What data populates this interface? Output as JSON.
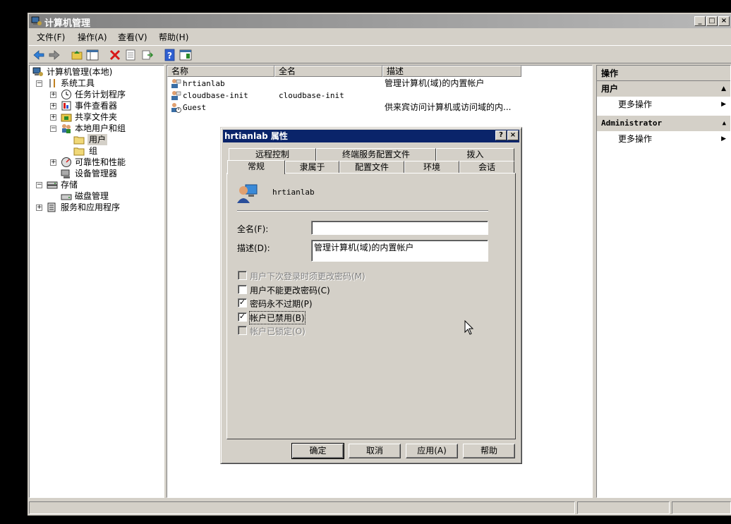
{
  "window": {
    "title": "计算机管理",
    "min": "_",
    "max": "□",
    "close": "×"
  },
  "menu": [
    "文件(F)",
    "操作(A)",
    "查看(V)",
    "帮助(H)"
  ],
  "tree": {
    "root": "计算机管理(本地)",
    "system_tools": "系统工具",
    "task_scheduler": "任务计划程序",
    "event_viewer": "事件查看器",
    "shared_folders": "共享文件夹",
    "local_users": "本地用户和组",
    "users": "用户",
    "groups": "组",
    "reliability": "可靠性和性能",
    "device_manager": "设备管理器",
    "storage": "存储",
    "disk_management": "磁盘管理",
    "services_apps": "服务和应用程序"
  },
  "list": {
    "columns": [
      "名称",
      "全名",
      "描述"
    ],
    "rows": [
      {
        "name": "hrtianlab",
        "fullname": "",
        "desc": "管理计算机(域)的内置帐户"
      },
      {
        "name": "cloudbase-init",
        "fullname": "cloudbase-init",
        "desc": ""
      },
      {
        "name": "Guest",
        "fullname": "",
        "desc": "供来宾访问计算机或访问域的内..."
      }
    ]
  },
  "actions": {
    "header": "操作",
    "section1": "用户",
    "more1": "更多操作",
    "section2": "Administrator",
    "more2": "更多操作"
  },
  "dialog": {
    "title": "hrtianlab 属性",
    "help": "?",
    "close": "×",
    "tabs_back": [
      "远程控制",
      "终端服务配置文件",
      "拨入"
    ],
    "tabs_front": [
      "常规",
      "隶属于",
      "配置文件",
      "环境",
      "会话"
    ],
    "username": "hrtianlab",
    "fullname_label": "全名(F):",
    "fullname_value": "",
    "desc_label": "描述(D):",
    "desc_value": "管理计算机(域)的内置帐户",
    "checkboxes": [
      {
        "label": "用户下次登录时须更改密码(M)",
        "checked": false,
        "disabled": true
      },
      {
        "label": "用户不能更改密码(C)",
        "checked": false,
        "disabled": false
      },
      {
        "label": "密码永不过期(P)",
        "checked": true,
        "disabled": false
      },
      {
        "label": "帐户已禁用(B)",
        "checked": true,
        "disabled": false
      },
      {
        "label": "帐户已锁定(O)",
        "checked": false,
        "disabled": true
      }
    ],
    "buttons": {
      "ok": "确定",
      "cancel": "取消",
      "apply": "应用(A)",
      "help": "帮助"
    }
  }
}
